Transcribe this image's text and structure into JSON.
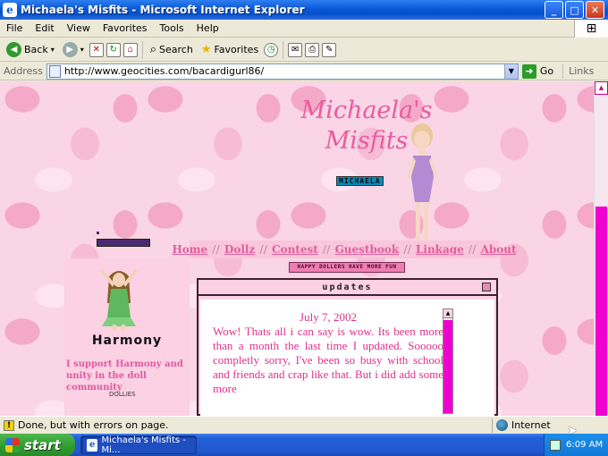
{
  "window": {
    "title": "Michaela's Misfits - Microsoft Internet Explorer",
    "buttons": {
      "minimize": "_",
      "maximize": "□",
      "close": "✕"
    }
  },
  "menu": [
    "File",
    "Edit",
    "View",
    "Favorites",
    "Tools",
    "Help"
  ],
  "toolbar": {
    "back": "Back",
    "search": "Search",
    "favorites": "Favorites"
  },
  "address": {
    "label": "Address",
    "url": "http://www.geocities.com/bacardigurl86/",
    "go": "Go",
    "links": "Links"
  },
  "page": {
    "title_line1": "Michaela's",
    "title_line2": "Misfits",
    "name_badge": "MICHAELA",
    "nav": [
      "Home",
      "Dollz",
      "Contest",
      "Guestbook",
      "Linkage",
      "About"
    ],
    "nav_separator": "//",
    "happy_banner": "HAPPY DOLLERS HAVE MORE FUN",
    "sidebar": {
      "harmony_name": "Harmony",
      "support_text": "I support Harmony and unity in the doll community",
      "dollies_label": "DOLLIES"
    },
    "updates": {
      "header": "updates",
      "date": "July 7, 2002",
      "text": "Wow! Thats all i can say is wow. Its been more than a month the last time I updated. Sooooo completly sorry, I've been so busy with school and friends and crap like that. But i did add some more"
    }
  },
  "status": {
    "message": "Done, but with errors on page.",
    "zone": "Internet"
  },
  "taskbar": {
    "start": "start",
    "task": "Michaela's Misfits - Mi...",
    "clock": "6:09 AM"
  },
  "colors": {
    "accent_pink": "#e15d9b",
    "scroll_magenta": "#f000d0"
  }
}
